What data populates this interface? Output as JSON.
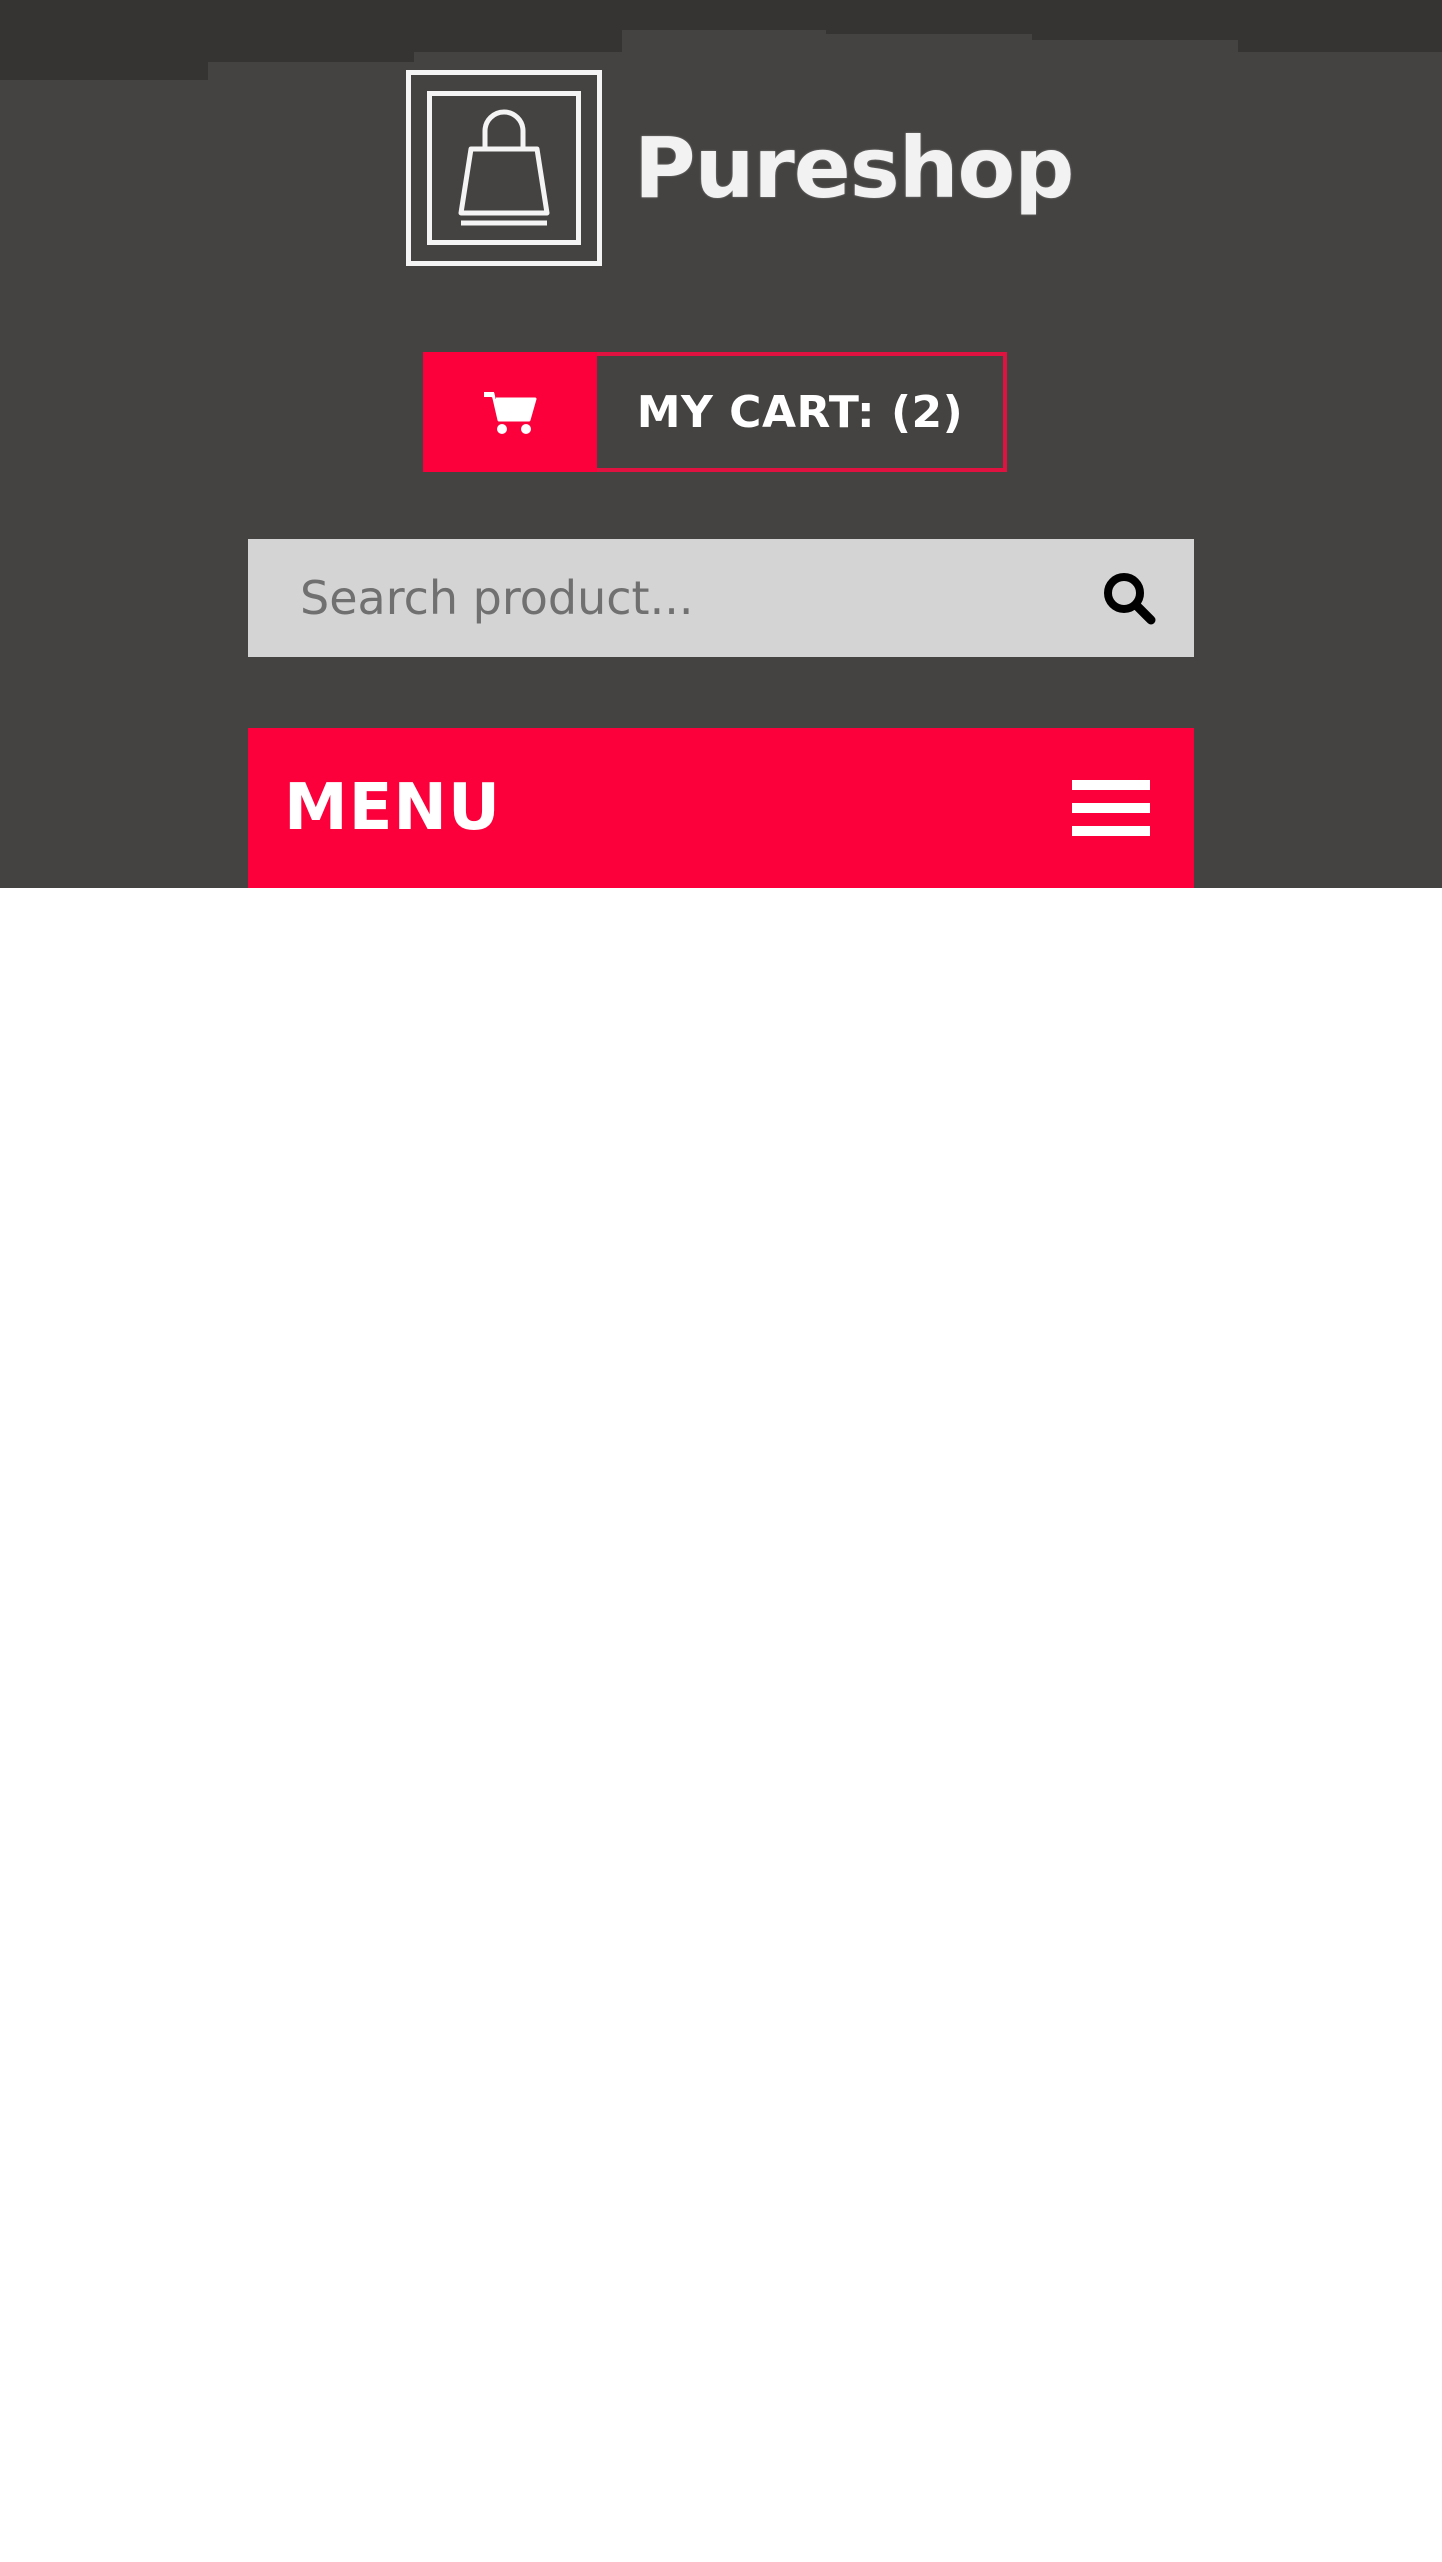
{
  "header": {
    "logo_text": "Pureshop",
    "logo_icon": "shopping-bag-icon",
    "cart": {
      "label": "MY CART: (2)",
      "icon": "cart-icon"
    },
    "search": {
      "placeholder": "Search product...",
      "value": "",
      "icon": "search-icon"
    },
    "menu": {
      "label": "MENU",
      "icon": "hamburger-icon"
    }
  },
  "colors": {
    "header_bg": "#454342",
    "accent": "#fb003b",
    "search_bg": "#d4d4d4"
  }
}
